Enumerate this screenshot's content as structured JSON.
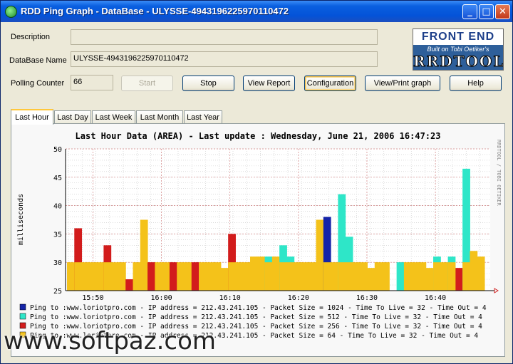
{
  "window": {
    "title": "RDD Ping Graph - DataBase - ULYSSE-4943196225970110472",
    "min_glyph": "_",
    "max_glyph": "□",
    "close_glyph": "✕"
  },
  "form": {
    "description_label": "Description",
    "description_value": "",
    "database_label": "DataBase Name",
    "database_value": "ULYSSE-4943196225970110472",
    "polling_label": "Polling Counter",
    "polling_value": "66"
  },
  "buttons": {
    "start": "Start",
    "stop": "Stop",
    "view_report": "View Report",
    "configuration": "Configuration",
    "view_print": "View/Print graph",
    "help": "Help"
  },
  "logo": {
    "top": "FRONT END",
    "sub": "Built on Tobi Oetiker's",
    "main": "RRDTOOL"
  },
  "tabs": [
    "Last Hour",
    "Last Day",
    "Last Week",
    "Last Month",
    "Last Year"
  ],
  "active_tab": 0,
  "chart_side_text": "RRDTOOL / TOBI OETIKER",
  "watermark": "www.softpaz.com",
  "colors": {
    "series_1024": "#1524a8",
    "series_512": "#2ee6c8",
    "series_256": "#d21c1c",
    "series_64": "#f4c21a",
    "grid_major": "#d08080",
    "grid_minor": "#c8c8c8",
    "arrow": "#d02020"
  },
  "chart_data": {
    "type": "area",
    "title": "Last Hour Data (AREA) - Last update : Wednesday, June 21, 2006 16:47:23",
    "ylabel": "milliseconds",
    "ylim": [
      25,
      50
    ],
    "yticks": [
      25,
      30,
      35,
      40,
      45,
      50
    ],
    "xlim": [
      "15:46",
      "16:48"
    ],
    "xticks": [
      "15:50",
      "16:00",
      "16:10",
      "16:20",
      "16:30",
      "16:40"
    ],
    "grid": true,
    "legend_position": "bottom",
    "series": [
      {
        "name": "Ping to :www.loriotpro.com - IP address = 212.43.241.105 - Packet Size = 1024 - Time To Live = 32 - Time Out = 4",
        "color_key": "series_1024",
        "points": [
          [
            24.5,
            38.0
          ],
          [
            24.7,
            38.0
          ]
        ]
      },
      {
        "name": "Ping to :www.loriotpro.com - IP address = 212.43.241.105 - Packet Size = 512 - Time To Live = 32 - Time Out = 4",
        "color_key": "series_512",
        "points": [
          [
            18.0,
            31.0
          ],
          [
            21.0,
            33.0
          ],
          [
            22.0,
            31.0
          ],
          [
            26.0,
            42.0
          ],
          [
            27.0,
            34.5
          ],
          [
            28.0,
            31.0
          ],
          [
            30.0,
            30.0
          ],
          [
            31.0,
            29.0
          ],
          [
            32.5,
            31.0
          ],
          [
            37.0,
            31.0
          ],
          [
            38.0,
            31.0
          ],
          [
            41.0,
            31.0
          ],
          [
            42.0,
            32.0
          ],
          [
            43.0,
            46.5
          ],
          [
            44.0,
            32.0
          ]
        ]
      },
      {
        "name": "Ping to :www.loriotpro.com - IP address = 212.43.241.105 - Packet Size = 256 - Time To Live = 32 - Time Out = 4",
        "color_key": "series_256",
        "points": [
          [
            0.0,
            36.0
          ],
          [
            1.0,
            36.0
          ],
          [
            5.0,
            33.0
          ],
          [
            9.0,
            30.0
          ],
          [
            12.0,
            30.0
          ],
          [
            15.0,
            35.0
          ],
          [
            20.0,
            30.0
          ],
          [
            41.5,
            29.0
          ],
          [
            43.0,
            40.5
          ]
        ]
      },
      {
        "name": "Ping to :www.loriotpro.com - IP address = 212.43.241.105 - Packet Size = 64 - Time To Live = 32 - Time Out = 4",
        "color_key": "series_64",
        "points": [
          [
            0.0,
            30.0
          ],
          [
            5.0,
            30.0
          ],
          [
            10.0,
            37.5
          ],
          [
            12.0,
            30.0
          ],
          [
            18.0,
            30.0
          ],
          [
            20.0,
            31.0
          ],
          [
            23.5,
            37.5
          ],
          [
            28.0,
            30.0
          ],
          [
            32.0,
            30.0
          ],
          [
            37.0,
            30.0
          ],
          [
            42.0,
            30.0
          ],
          [
            43.0,
            39.5
          ],
          [
            44.0,
            31.5
          ],
          [
            45.0,
            31.0
          ]
        ]
      }
    ],
    "bars": [
      [
        0,
        30,
        "series_64"
      ],
      [
        1,
        36,
        "series_256"
      ],
      [
        2,
        30,
        "series_64"
      ],
      [
        3,
        30,
        "series_64"
      ],
      [
        4,
        30,
        "series_64"
      ],
      [
        5,
        33,
        "series_256"
      ],
      [
        6,
        30,
        "series_64"
      ],
      [
        7,
        30,
        "series_64"
      ],
      [
        8,
        27,
        "series_256"
      ],
      [
        9,
        30,
        "series_64"
      ],
      [
        10,
        37.5,
        "series_64"
      ],
      [
        11,
        30,
        "series_256"
      ],
      [
        12,
        30,
        "series_64"
      ],
      [
        13,
        30,
        "series_64"
      ],
      [
        14,
        30,
        "series_256"
      ],
      [
        15,
        30,
        "series_64"
      ],
      [
        16,
        30,
        "series_64"
      ],
      [
        17,
        30,
        "series_256"
      ],
      [
        18,
        30,
        "series_64"
      ],
      [
        19,
        30,
        "series_64"
      ],
      [
        20,
        30,
        "series_64"
      ],
      [
        21,
        29,
        "series_64"
      ],
      [
        22,
        35,
        "series_256"
      ],
      [
        23,
        30,
        "series_64"
      ],
      [
        24,
        30,
        "series_64"
      ],
      [
        25,
        31,
        "series_64"
      ],
      [
        26,
        31,
        "series_64"
      ],
      [
        27,
        31,
        "series_512"
      ],
      [
        28,
        31,
        "series_64"
      ],
      [
        29,
        33,
        "series_512"
      ],
      [
        30,
        31,
        "series_512"
      ],
      [
        31,
        30,
        "series_64"
      ],
      [
        32,
        30,
        "series_64"
      ],
      [
        33,
        30,
        "series_64"
      ],
      [
        34,
        37.5,
        "series_64"
      ],
      [
        35,
        38,
        "series_1024"
      ],
      [
        36,
        30,
        "series_64"
      ],
      [
        37,
        42,
        "series_512"
      ],
      [
        38,
        34.5,
        "series_512"
      ],
      [
        39,
        30,
        "series_64"
      ],
      [
        40,
        30,
        "series_64"
      ],
      [
        41,
        29,
        "series_64"
      ],
      [
        42,
        30,
        "series_64"
      ],
      [
        43,
        30,
        "series_64"
      ],
      [
        44,
        25,
        "series_512"
      ],
      [
        45,
        30,
        "series_512"
      ],
      [
        46,
        30,
        "series_64"
      ],
      [
        47,
        30,
        "series_64"
      ],
      [
        48,
        30,
        "series_64"
      ],
      [
        49,
        29,
        "series_64"
      ],
      [
        50,
        31,
        "series_512"
      ],
      [
        51,
        30,
        "series_64"
      ],
      [
        52,
        31,
        "series_512"
      ],
      [
        53,
        29,
        "series_256"
      ],
      [
        54,
        46.5,
        "series_512"
      ],
      [
        55,
        32,
        "series_64"
      ],
      [
        56,
        31,
        "series_64"
      ]
    ]
  }
}
